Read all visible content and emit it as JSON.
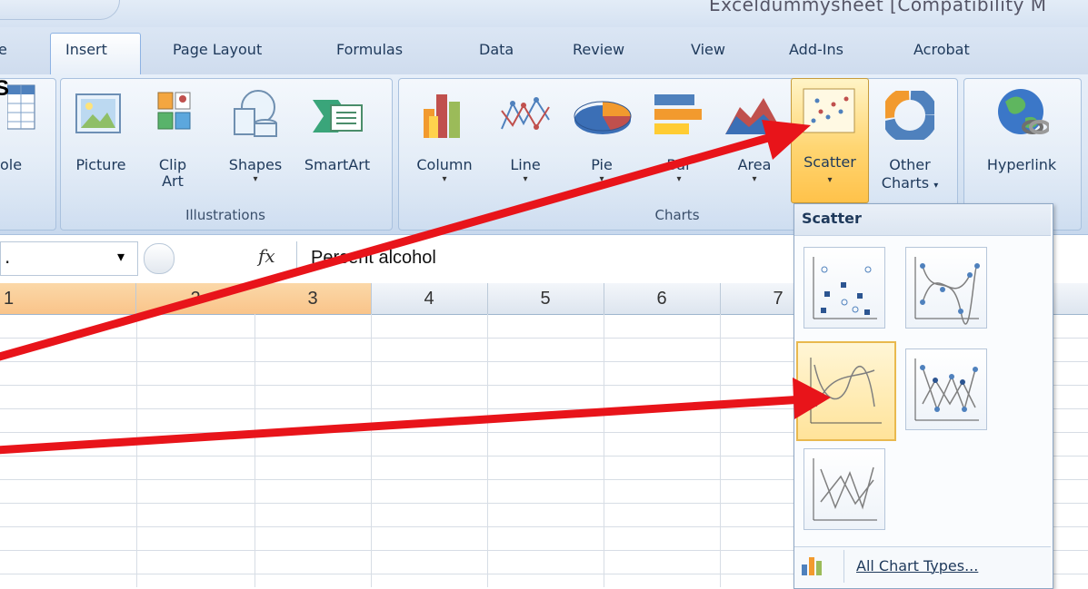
{
  "window": {
    "title": "Exceldummysheet [Compatibility M"
  },
  "tabs": [
    "e",
    "Insert",
    "Page Layout",
    "Formulas",
    "Data",
    "Review",
    "View",
    "Add-Ins",
    "Acrobat"
  ],
  "annotation_text": "S",
  "ribbon": {
    "table_partial_label": "ole",
    "picture_label": "Picture",
    "clipart_label_1": "Clip",
    "clipart_label_2": "Art",
    "shapes_label": "Shapes",
    "smartart_label": "SmartArt",
    "illustrations_group": "Illustrations",
    "column_label": "Column",
    "line_label": "Line",
    "pie_label": "Pie",
    "bar_label": "Bar",
    "area_label": "Area",
    "scatter_label": "Scatter",
    "other_label_1": "Other",
    "other_label_2": "Charts",
    "charts_group": "Charts",
    "hyperlink_label": "Hyperlink"
  },
  "formula_bar": {
    "name_box_value": ".",
    "fx_label": "fx",
    "formula_value": "Percent alcohol"
  },
  "columns": [
    "1",
    "2",
    "3",
    "4",
    "5",
    "6",
    "7"
  ],
  "scatter_menu": {
    "title": "Scatter",
    "options": [
      {
        "icon": "scatter-markers-only-icon"
      },
      {
        "icon": "scatter-smooth-lines-markers-icon"
      },
      {
        "icon": "scatter-smooth-lines-icon"
      },
      {
        "icon": "scatter-straight-lines-markers-icon"
      },
      {
        "icon": "scatter-straight-lines-icon"
      }
    ],
    "footer_label": "All Chart Types..."
  },
  "colors": {
    "annotation_arrow": "#e8141a",
    "selected_button": "#ffd673",
    "column_header_highlight": "#f9c48a"
  }
}
